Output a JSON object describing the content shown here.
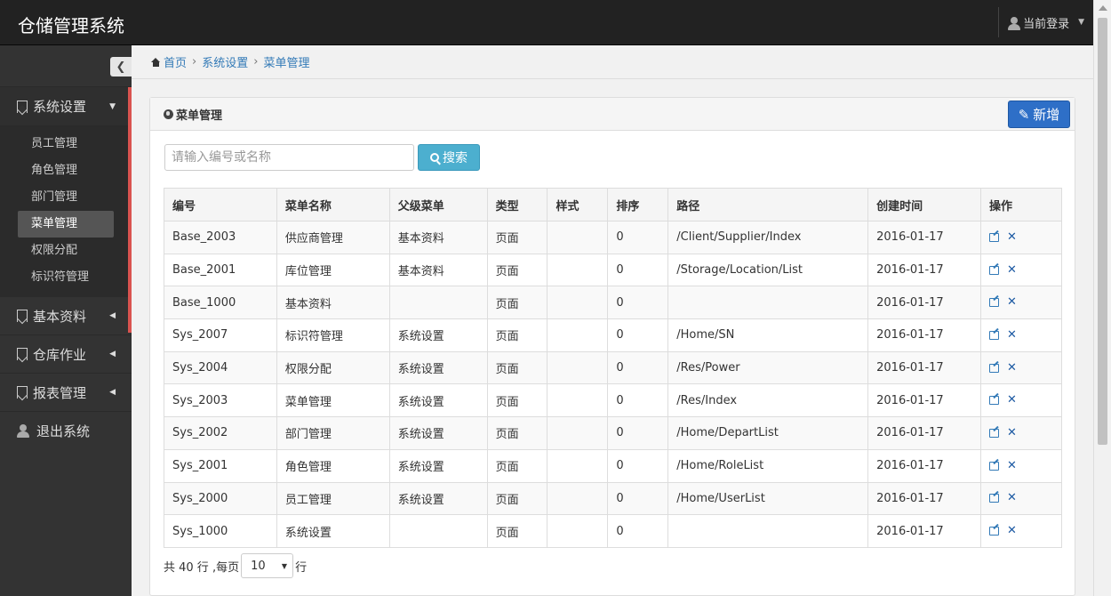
{
  "app": {
    "title": "仓储管理系统",
    "user_menu": "当前登录"
  },
  "sidebar": {
    "groups": [
      {
        "label": "系统设置",
        "open": true
      },
      {
        "label": "基本资料"
      },
      {
        "label": "仓库作业"
      },
      {
        "label": "报表管理"
      }
    ],
    "sub_items": [
      "员工管理",
      "角色管理",
      "部门管理",
      "菜单管理",
      "权限分配",
      "标识符管理"
    ],
    "active_sub": "菜单管理",
    "exit_label": "退出系统"
  },
  "breadcrumb": [
    "首页",
    "系统设置",
    "菜单管理"
  ],
  "panel": {
    "title": "菜单管理",
    "add_label": "新增"
  },
  "search": {
    "placeholder": "请输入编号或名称",
    "button_label": "搜索"
  },
  "table": {
    "headers": [
      "编号",
      "菜单名称",
      "父级菜单",
      "类型",
      "样式",
      "排序",
      "路径",
      "创建时间",
      "操作"
    ],
    "rows": [
      [
        "Base_2003",
        "供应商管理",
        "基本资料",
        "页面",
        "",
        "0",
        "/Client/Supplier/Index",
        "2016-01-17"
      ],
      [
        "Base_2001",
        "库位管理",
        "基本资料",
        "页面",
        "",
        "0",
        "/Storage/Location/List",
        "2016-01-17"
      ],
      [
        "Base_1000",
        "基本资料",
        "",
        "页面",
        "",
        "0",
        "",
        "2016-01-17"
      ],
      [
        "Sys_2007",
        "标识符管理",
        "系统设置",
        "页面",
        "",
        "0",
        "/Home/SN",
        "2016-01-17"
      ],
      [
        "Sys_2004",
        "权限分配",
        "系统设置",
        "页面",
        "",
        "0",
        "/Res/Power",
        "2016-01-17"
      ],
      [
        "Sys_2003",
        "菜单管理",
        "系统设置",
        "页面",
        "",
        "0",
        "/Res/Index",
        "2016-01-17"
      ],
      [
        "Sys_2002",
        "部门管理",
        "系统设置",
        "页面",
        "",
        "0",
        "/Home/DepartList",
        "2016-01-17"
      ],
      [
        "Sys_2001",
        "角色管理",
        "系统设置",
        "页面",
        "",
        "0",
        "/Home/RoleList",
        "2016-01-17"
      ],
      [
        "Sys_2000",
        "员工管理",
        "系统设置",
        "页面",
        "",
        "0",
        "/Home/UserList",
        "2016-01-17"
      ],
      [
        "Sys_1000",
        "系统设置",
        "",
        "页面",
        "",
        "0",
        "",
        "2016-01-17"
      ]
    ]
  },
  "pager": {
    "prefix": "共 40 行 ,每页",
    "page_size": "10",
    "suffix": "行"
  }
}
